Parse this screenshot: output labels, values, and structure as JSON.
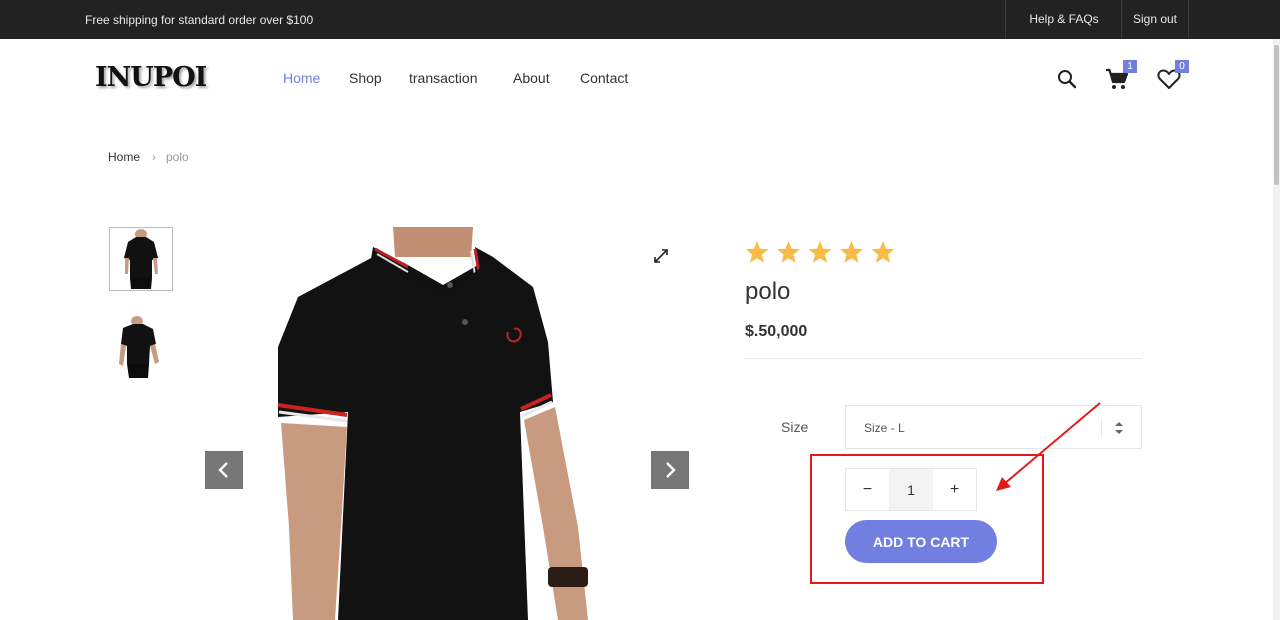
{
  "topbar": {
    "shipping_text": "Free shipping for standard order over $100",
    "help_label": "Help & FAQs",
    "signout_label": "Sign out"
  },
  "header": {
    "logo_text": "INUPOI",
    "nav": [
      "Home",
      "Shop",
      "transaction",
      "About",
      "Contact"
    ],
    "active_nav": "Home",
    "cart_count": "1",
    "wishlist_count": "0"
  },
  "breadcrumb": {
    "home": "Home",
    "separator": "›",
    "current": "polo"
  },
  "product": {
    "rating_stars": 5,
    "name": "polo",
    "price": "$.50,000",
    "size_label": "Size",
    "size_selected": "Size - L",
    "quantity": "1",
    "minus_label": "−",
    "plus_label": "+",
    "add_to_cart_label": "ADD TO CART"
  },
  "colors": {
    "accent": "#717fe0",
    "topbar_bg": "#222222",
    "star": "#f9ba48",
    "annotation": "#e01b1b"
  }
}
